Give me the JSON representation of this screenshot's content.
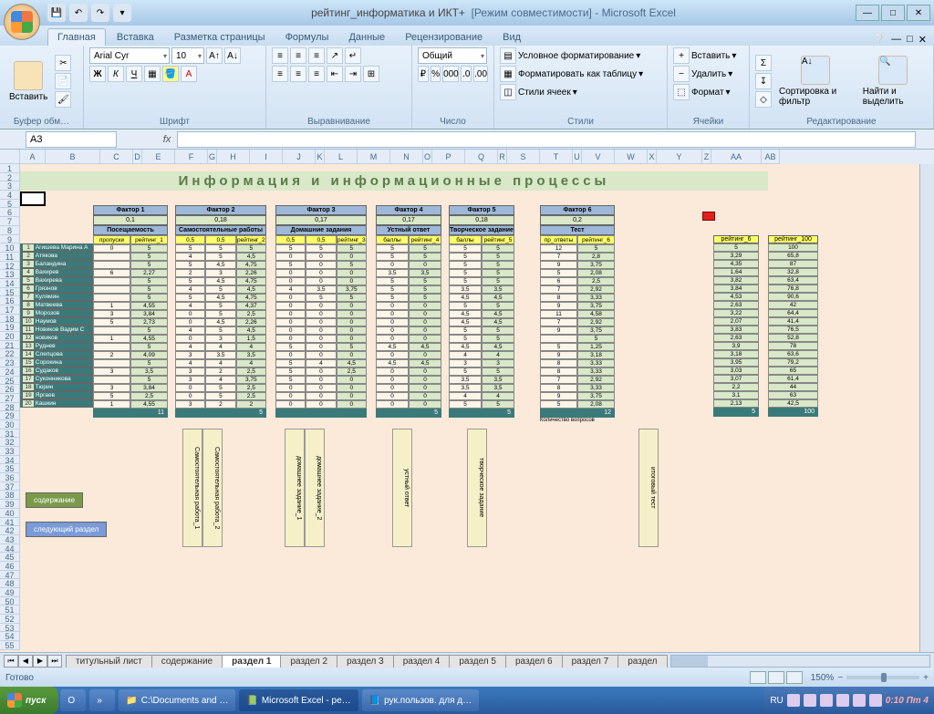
{
  "title": {
    "doc": "рейтинг_информатика и ИКТ+",
    "mode": "[Режим совместимости]",
    "app": "Microsoft Excel"
  },
  "qat": [
    "💾",
    "↶",
    "↷"
  ],
  "tabs": [
    "Главная",
    "Вставка",
    "Разметка страницы",
    "Формулы",
    "Данные",
    "Рецензирование",
    "Вид"
  ],
  "ribbon": {
    "clipboard": {
      "paste": "Вставить",
      "label": "Буфер обм…"
    },
    "font": {
      "name": "Arial Cyr",
      "size": "10",
      "label": "Шрифт"
    },
    "align": {
      "label": "Выравнивание"
    },
    "number": {
      "format": "Общий",
      "label": "Число"
    },
    "styles": {
      "cond": "Условное форматирование",
      "table": "Форматировать как таблицу",
      "cell": "Стили ячеек",
      "label": "Стили"
    },
    "cells": {
      "ins": "Вставить",
      "del": "Удалить",
      "fmt": "Формат",
      "label": "Ячейки"
    },
    "edit": {
      "sort": "Сортировка и фильтр",
      "find": "Найти и выделить",
      "label": "Редактирование"
    }
  },
  "namebox": "A3",
  "cols": [
    "A",
    "B",
    "C",
    "D",
    "E",
    "F",
    "G",
    "H",
    "I",
    "J",
    "K",
    "L",
    "M",
    "N",
    "O",
    "P",
    "Q",
    "R",
    "S",
    "T",
    "U",
    "V",
    "W",
    "X",
    "Y",
    "Z",
    "AA",
    "AB"
  ],
  "page_title": "Информация  и  информационные   процессы",
  "students": [
    "Агишева Марина А",
    "Атякова",
    "Баландина",
    "Вахирев",
    "Вахирева",
    "Грязнов",
    "Кулямин",
    "Матвеева",
    "Морозов",
    "Наумов",
    "Новиков Вадим С",
    "новиков",
    "Руднев",
    "Слепцова",
    "Сорокина",
    "Судаков",
    "Суконникова",
    "Тюрин",
    "Яргаев",
    "Кашкин"
  ],
  "factors": [
    {
      "name": "Фактор 1",
      "w": "0,1",
      "sub": "Посещаемость",
      "cols": [
        "пропуски",
        "рейтинг_1"
      ],
      "data": [
        [
          "0",
          "5"
        ],
        [
          "",
          "5"
        ],
        [
          "",
          "5"
        ],
        [
          "6",
          "2,27"
        ],
        [
          "",
          "5"
        ],
        [
          "",
          "5"
        ],
        [
          "",
          "5"
        ],
        [
          "1",
          "4,55"
        ],
        [
          "3",
          "3,84"
        ],
        [
          "5",
          "2,73"
        ],
        [
          "",
          "5"
        ],
        [
          "1",
          "4,55"
        ],
        [
          "",
          "5"
        ],
        [
          "2",
          "4,09"
        ],
        [
          "",
          "5"
        ],
        [
          "3",
          "3,5"
        ],
        [
          "",
          "5"
        ],
        [
          "3",
          "3,84"
        ],
        [
          "5",
          "2,5"
        ],
        [
          "1",
          "4,55"
        ]
      ],
      "foot": "11"
    },
    {
      "name": "Фактор 2",
      "w": "0,18",
      "sub": "Самостоятельные работы",
      "cols": [
        "0,5",
        "0,5",
        "рейтинг_2"
      ],
      "data": [
        [
          "5",
          "5",
          "5"
        ],
        [
          "4",
          "5",
          "4,5"
        ],
        [
          "5",
          "4,5",
          "4,75"
        ],
        [
          "2",
          "3",
          "2,26"
        ],
        [
          "5",
          "4,5",
          "4,75"
        ],
        [
          "4",
          "5",
          "4,5"
        ],
        [
          "5",
          "4,5",
          "4,75"
        ],
        [
          "4",
          "5",
          "4,37"
        ],
        [
          "0",
          "5",
          "2,5"
        ],
        [
          "0",
          "4,5",
          "2,26"
        ],
        [
          "4",
          "5",
          "4,5"
        ],
        [
          "0",
          "3",
          "1,5"
        ],
        [
          "4",
          "4",
          "4"
        ],
        [
          "3",
          "3,5",
          "3,5"
        ],
        [
          "4",
          "4",
          "4"
        ],
        [
          "3",
          "2",
          "2,5"
        ],
        [
          "3",
          "4",
          "3,75"
        ],
        [
          "0",
          "5",
          "2,5"
        ],
        [
          "0",
          "5",
          "2,5"
        ],
        [
          "3",
          "2",
          "2"
        ]
      ],
      "foot": "5"
    },
    {
      "name": "Фактор 3",
      "w": "0,17",
      "sub": "Домашние задания",
      "cols": [
        "0,5",
        "0,5",
        "рейтинг_3"
      ],
      "data": [
        [
          "5",
          "5",
          "5"
        ],
        [
          "0",
          "0",
          "0"
        ],
        [
          "5",
          "0",
          "5"
        ],
        [
          "0",
          "0",
          "0"
        ],
        [
          "0",
          "0",
          "0"
        ],
        [
          "4",
          "3,5",
          "3,75"
        ],
        [
          "0",
          "5",
          "5"
        ],
        [
          "0",
          "0",
          "0"
        ],
        [
          "0",
          "0",
          "0"
        ],
        [
          "0",
          "0",
          "0"
        ],
        [
          "0",
          "0",
          "0"
        ],
        [
          "0",
          "0",
          "0"
        ],
        [
          "5",
          "0",
          "5"
        ],
        [
          "0",
          "0",
          "0"
        ],
        [
          "5",
          "4",
          "4,5"
        ],
        [
          "5",
          "0",
          "2,5"
        ],
        [
          "5",
          "0",
          "0"
        ],
        [
          "0",
          "0",
          "0"
        ],
        [
          "0",
          "0",
          "0"
        ],
        [
          "0",
          "0",
          "0"
        ]
      ],
      "foot": ""
    },
    {
      "name": "Фактор 4",
      "w": "0,17",
      "sub": "Устный ответ",
      "cols": [
        "баллы",
        "рейтинг_4"
      ],
      "data": [
        [
          "5",
          "5"
        ],
        [
          "5",
          "5"
        ],
        [
          "0",
          "0"
        ],
        [
          "3,5",
          "3,5"
        ],
        [
          "5",
          "5"
        ],
        [
          "5",
          "5"
        ],
        [
          "5",
          "5"
        ],
        [
          "0",
          "0"
        ],
        [
          "0",
          "0"
        ],
        [
          "0",
          "0"
        ],
        [
          "0",
          "0"
        ],
        [
          "0",
          "0"
        ],
        [
          "4,5",
          "4,5"
        ],
        [
          "0",
          "0"
        ],
        [
          "4,5",
          "4,5"
        ],
        [
          "0",
          "0"
        ],
        [
          "0",
          "0"
        ],
        [
          "0",
          "0"
        ],
        [
          "0",
          "0"
        ],
        [
          "0",
          "0"
        ]
      ],
      "foot": "5"
    },
    {
      "name": "Фактор 5",
      "w": "0,18",
      "sub": "Творческое задание",
      "cols": [
        "баллы",
        "рейтинг_5"
      ],
      "data": [
        [
          "5",
          "5"
        ],
        [
          "5",
          "5"
        ],
        [
          "5",
          "5"
        ],
        [
          "5",
          "5"
        ],
        [
          "5",
          "5"
        ],
        [
          "3,5",
          "3,5"
        ],
        [
          "4,5",
          "4,5"
        ],
        [
          "5",
          "5"
        ],
        [
          "4,5",
          "4,5"
        ],
        [
          "4,5",
          "4,5"
        ],
        [
          "5",
          "5"
        ],
        [
          "5",
          "5"
        ],
        [
          "4,5",
          "4,5"
        ],
        [
          "4",
          "4"
        ],
        [
          "3",
          "3"
        ],
        [
          "5",
          "5"
        ],
        [
          "3,5",
          "3,5"
        ],
        [
          "3,5",
          "3,5"
        ],
        [
          "4",
          "4"
        ],
        [
          "5",
          "5"
        ]
      ],
      "foot": "5"
    },
    {
      "name": "Фактор 6",
      "w": "0,2",
      "sub": "Тест",
      "cols": [
        "пр_ответы",
        "рейтинг_6"
      ],
      "data": [
        [
          "12",
          "5"
        ],
        [
          "7",
          "2,8"
        ],
        [
          "9",
          "3,75"
        ],
        [
          "5",
          "2,08"
        ],
        [
          "6",
          "2,5"
        ],
        [
          "7",
          "2,92"
        ],
        [
          "8",
          "3,33"
        ],
        [
          "9",
          "3,75"
        ],
        [
          "11",
          "4,58"
        ],
        [
          "7",
          "2,92"
        ],
        [
          "9",
          "3,75"
        ],
        [
          "",
          "5"
        ],
        [
          "5",
          "1,25"
        ],
        [
          "9",
          "3,18"
        ],
        [
          "8",
          "3,33"
        ],
        [
          "8",
          "3,33"
        ],
        [
          "7",
          "2,92"
        ],
        [
          "8",
          "3,33"
        ],
        [
          "9",
          "3,75"
        ],
        [
          "5",
          "2,08"
        ]
      ],
      "foot": "12",
      "extra": "Количество вопросов"
    }
  ],
  "rating": {
    "hdr": "рейтинг_6",
    "vals": [
      "5",
      "3,29",
      "4,35",
      "1,64",
      "3,82",
      "3,84",
      "4,53",
      "2,63",
      "3,22",
      "2,07",
      "3,83",
      "2,63",
      "3,9",
      "3,18",
      "3,95",
      "3,03",
      "3,07",
      "2,2",
      "3,1",
      "2,13"
    ],
    "foot": "5"
  },
  "rating100": {
    "hdr": "рейтинг_100",
    "vals": [
      "100",
      "65,8",
      "87",
      "32,8",
      "63,4",
      "76,8",
      "90,6",
      "42",
      "64,4",
      "41,4",
      "76,5",
      "52,8",
      "78",
      "63,6",
      "79,2",
      "65",
      "61,4",
      "44",
      "63",
      "42,5"
    ],
    "foot": "100"
  },
  "vlabels": [
    "Самостоятельная работа_1",
    "Самостоятельная работа_2",
    "домашнее задание_1",
    "домашнее задание_2",
    "устный ответ",
    "творческое задание",
    "итоговый тест"
  ],
  "nav": {
    "content": "содержание",
    "next": "следующий раздел"
  },
  "sheets": [
    "титульный лист",
    "содержание",
    "раздел 1",
    "раздел 2",
    "раздел 3",
    "раздел 4",
    "раздел 5",
    "раздел 6",
    "раздел 7",
    "раздел"
  ],
  "active_sheet": 2,
  "status": "Готово",
  "zoom": "150%",
  "taskbar": {
    "start": "пуск",
    "items": [
      "",
      "",
      "C:\\Documents and …",
      "Microsoft Excel - ре…",
      "рук.пользов. для д…"
    ],
    "lang": "RU",
    "time": "0:10 Пт 4"
  }
}
